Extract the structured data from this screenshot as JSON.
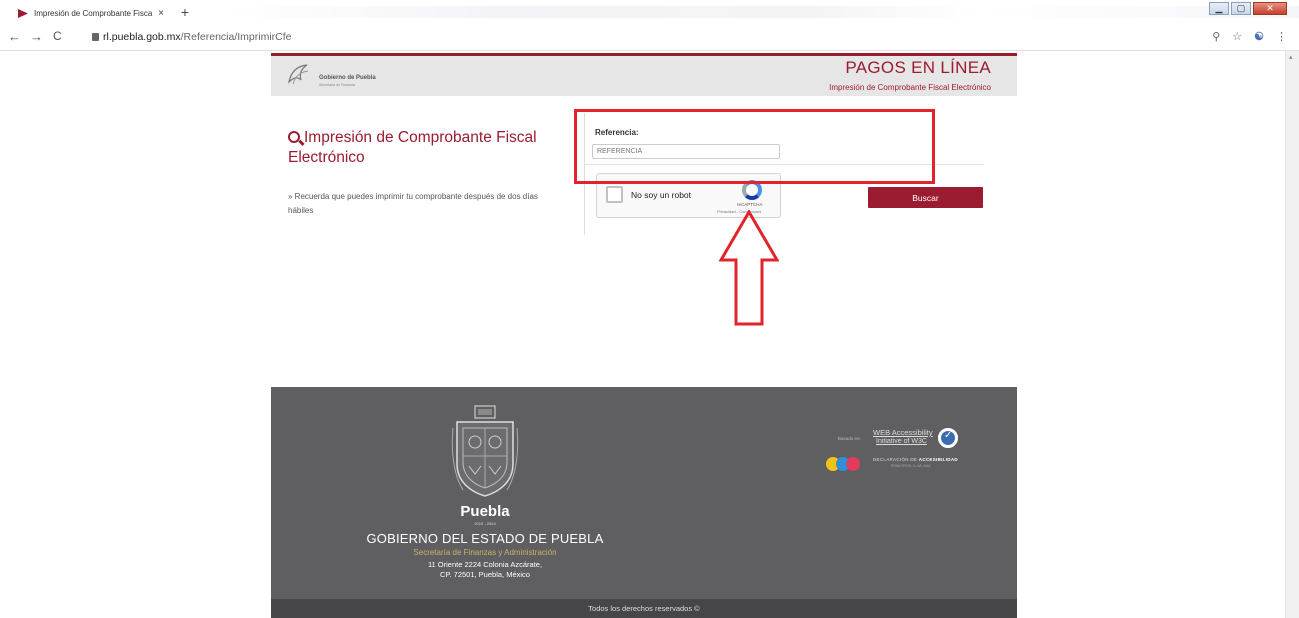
{
  "browser": {
    "tab_title": "Impresión de Comprobante Fisca",
    "tab_close": "×",
    "new_tab": "+",
    "url_domain": "rl.puebla.gob.mx",
    "url_path": "/Referencia/ImprimirCfe"
  },
  "header": {
    "logo_title": "Gobierno de Puebla",
    "logo_subtitle": "Secretaría de Finanzas",
    "title": "PAGOS EN LÍNEA",
    "subtitle": "Impresión de Comprobante Fiscal Electrónico"
  },
  "main": {
    "heading": "Impresión de Comprobante Fiscal Electrónico",
    "note": "» Recuerda que puedes imprimir tu comprobante después de dos días hábiles",
    "reference_label": "Referencia:",
    "reference_placeholder": "REFERENCIA",
    "reference_value": "",
    "captcha_label": "No soy un robot",
    "captcha_brand": "reCAPTCHA",
    "captcha_terms": "Privacidad - Condiciones",
    "search_button": "Buscar"
  },
  "footer": {
    "brand": "Puebla",
    "years": "2019 - 2024",
    "government": "GOBIERNO DEL ESTADO DE PUEBLA",
    "secretariat": "Secretaría de Finanzas y Administración",
    "address_line1": "11 Oriente 2224 Colonia Azcárate,",
    "address_line2": "CP. 72501, Puebla, México",
    "w3c_small": "Basado en:",
    "w3c_line1": "WEB Accessibility",
    "w3c_line2": "Initiative of W3C",
    "declaration": "DECLARACIÓN DE",
    "declaration_bold": "ACCESIBILIDAD",
    "declaration_sub": "PRINCIPIOS: A, AA, AAA",
    "copyright": "Todos los derechos reservados ©"
  },
  "colors": {
    "brand": "#9b1b30",
    "annotation": "#e3232c",
    "footer_bg": "#5f5f61",
    "header_bg": "#e6e6e6"
  }
}
